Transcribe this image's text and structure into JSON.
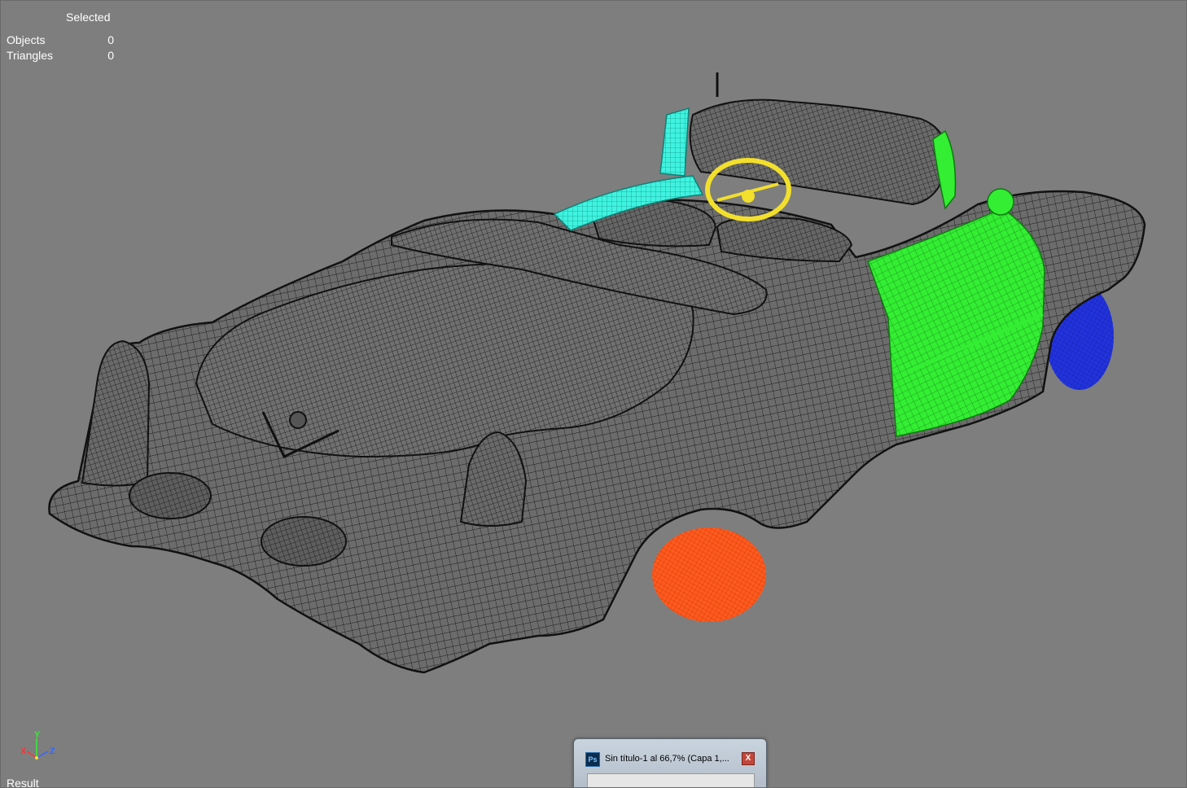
{
  "stats": {
    "header": "Selected",
    "rows": [
      {
        "label": "Objects",
        "value": "0"
      },
      {
        "label": "Triangles",
        "value": "0"
      }
    ]
  },
  "axis": {
    "x": "X",
    "y": "Y",
    "z": "Z"
  },
  "status": {
    "result_label": "Result"
  },
  "taskbar": {
    "window_title": "Sin título-1 al 66,7% (Capa 1,...",
    "app_icon": "Ps",
    "close_icon": "close-icon",
    "close_glyph": "X"
  },
  "colors": {
    "viewport": "#7e7e7e",
    "wire": "#1c1c1c",
    "cyan_part": "#3ff3e0",
    "green_part": "#33ee33",
    "yellow_part": "#f2df2c",
    "orange_wheel": "#ff5a1e",
    "blue_wheel": "#2233dd"
  }
}
